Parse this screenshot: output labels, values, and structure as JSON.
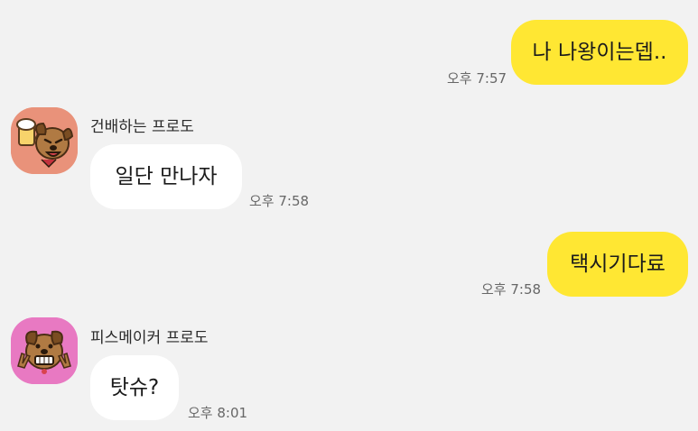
{
  "messages": [
    {
      "from": "me",
      "text": "나 나왕이는뎁..",
      "time": "오후 7:57"
    },
    {
      "from": "other",
      "sender": "건배하는 프로도",
      "avatar_icon": "frodo-toast-avatar-icon",
      "text": "일단 만나자",
      "time": "오후 7:58"
    },
    {
      "from": "me",
      "text": "택시기다료",
      "time": "오후 7:58"
    },
    {
      "from": "other",
      "sender": "피스메이커 프로도",
      "avatar_icon": "frodo-peace-avatar-icon",
      "text": "탓슈?",
      "time": "오후 8:01"
    }
  ],
  "colors": {
    "background": "#f2f2f2",
    "my_bubble": "#ffe733",
    "their_bubble": "#ffffff",
    "avatar_1_bg": "#e9927a",
    "avatar_2_bg": "#e879c2"
  }
}
